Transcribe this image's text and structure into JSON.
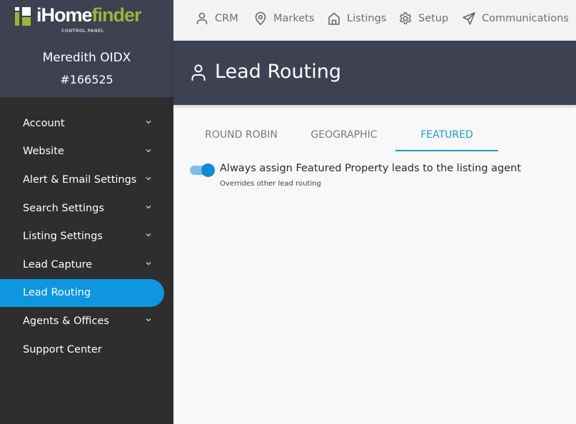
{
  "brand": {
    "name_white": "iHome",
    "name_green": "finder",
    "subtitle": "CONTROL PANEL",
    "green": "#9cb43a"
  },
  "account": {
    "name": "Meredith OIDX",
    "id": "#166525"
  },
  "sidebar": {
    "items": [
      {
        "label": "Account",
        "has_chevron": true,
        "active": false
      },
      {
        "label": "Website",
        "has_chevron": true,
        "active": false
      },
      {
        "label": "Alert & Email Settings",
        "has_chevron": true,
        "active": false
      },
      {
        "label": "Search Settings",
        "has_chevron": true,
        "active": false
      },
      {
        "label": "Listing Settings",
        "has_chevron": true,
        "active": false
      },
      {
        "label": "Lead Capture",
        "has_chevron": true,
        "active": false
      },
      {
        "label": "Lead Routing",
        "has_chevron": false,
        "active": true
      },
      {
        "label": "Agents & Offices",
        "has_chevron": true,
        "active": false
      },
      {
        "label": "Support Center",
        "has_chevron": false,
        "active": false
      }
    ],
    "active_color": "#0e96e0"
  },
  "topnav": {
    "items": [
      {
        "label": "CRM",
        "icon": "user-icon"
      },
      {
        "label": "Markets",
        "icon": "map-pin-icon"
      },
      {
        "label": "Listings",
        "icon": "home-icon"
      },
      {
        "label": "Setup",
        "icon": "gear-icon"
      },
      {
        "label": "Communications",
        "icon": "send-icon"
      }
    ]
  },
  "page": {
    "title": "Lead Routing",
    "icon": "user-icon"
  },
  "tabs": [
    {
      "label": "ROUND ROBIN",
      "active": false
    },
    {
      "label": "GEOGRAPHIC",
      "active": false
    },
    {
      "label": "FEATURED",
      "active": true
    }
  ],
  "featured": {
    "toggle_on": true,
    "label": "Always assign Featured Property leads to the listing agent",
    "sublabel": "Overrides other lead routing"
  }
}
